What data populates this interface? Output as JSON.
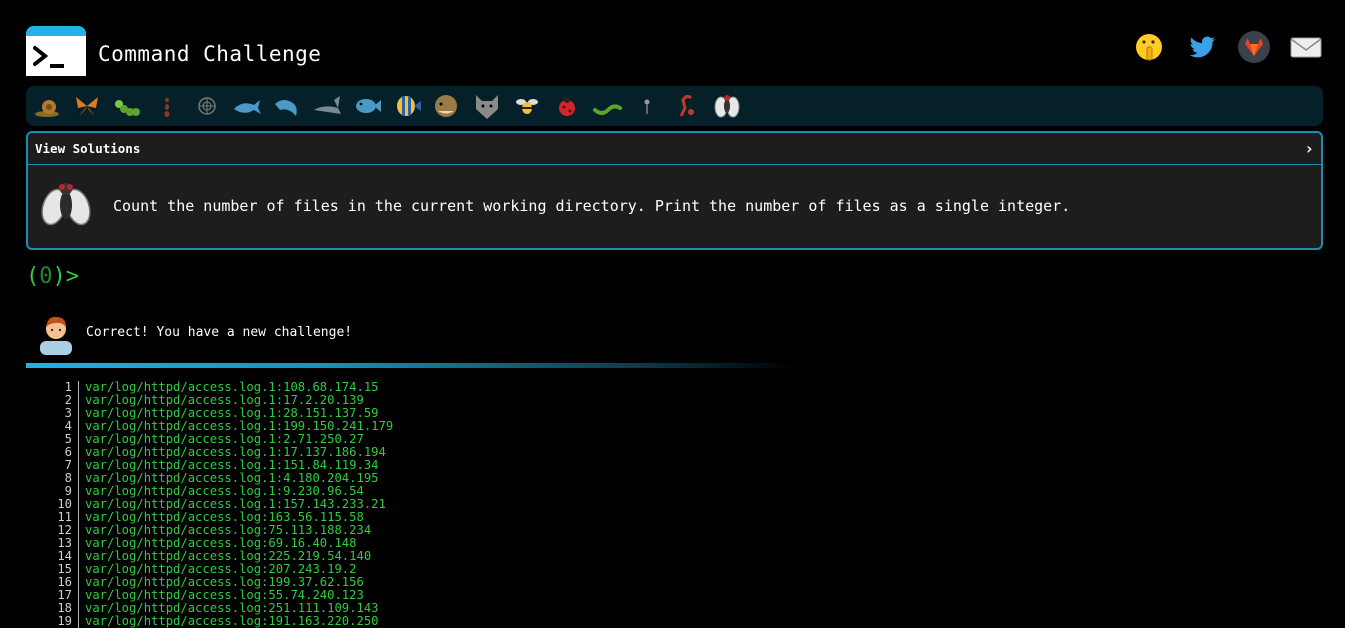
{
  "header": {
    "title": "Command Challenge",
    "social": [
      "shush-emoji-icon",
      "twitter-icon",
      "gitlab-icon",
      "mail-icon"
    ]
  },
  "critters": [
    "snail",
    "butterfly",
    "caterpillar",
    "ant",
    "spider-web",
    "whale",
    "dolphin",
    "shark",
    "fish",
    "tropical-fish",
    "blowfish",
    "wolf",
    "bee",
    "ladybug",
    "worm",
    "mosquito",
    "scorpion",
    "fly"
  ],
  "solutions": {
    "label": "View Solutions",
    "challenge": "Count the number of files in the current working directory. Print the number of files as a single integer."
  },
  "prompt": {
    "open": "(",
    "count": "0",
    "close": ")>"
  },
  "message": {
    "text": "Correct! You have a new challenge!"
  },
  "output": {
    "lines": [
      {
        "n": "1",
        "t": "var/log/httpd/access.log.1:108.68.174.15"
      },
      {
        "n": "2",
        "t": "var/log/httpd/access.log.1:17.2.20.139"
      },
      {
        "n": "3",
        "t": "var/log/httpd/access.log.1:28.151.137.59"
      },
      {
        "n": "4",
        "t": "var/log/httpd/access.log.1:199.150.241.179"
      },
      {
        "n": "5",
        "t": "var/log/httpd/access.log.1:2.71.250.27"
      },
      {
        "n": "6",
        "t": "var/log/httpd/access.log.1:17.137.186.194"
      },
      {
        "n": "7",
        "t": "var/log/httpd/access.log.1:151.84.119.34"
      },
      {
        "n": "8",
        "t": "var/log/httpd/access.log.1:4.180.204.195"
      },
      {
        "n": "9",
        "t": "var/log/httpd/access.log.1:9.230.96.54"
      },
      {
        "n": "10",
        "t": "var/log/httpd/access.log.1:157.143.233.21"
      },
      {
        "n": "11",
        "t": "var/log/httpd/access.log:163.56.115.58"
      },
      {
        "n": "12",
        "t": "var/log/httpd/access.log:75.113.188.234"
      },
      {
        "n": "13",
        "t": "var/log/httpd/access.log:69.16.40.148"
      },
      {
        "n": "14",
        "t": "var/log/httpd/access.log:225.219.54.140"
      },
      {
        "n": "15",
        "t": "var/log/httpd/access.log:207.243.19.2"
      },
      {
        "n": "16",
        "t": "var/log/httpd/access.log:199.37.62.156"
      },
      {
        "n": "17",
        "t": "var/log/httpd/access.log:55.74.240.123"
      },
      {
        "n": "18",
        "t": "var/log/httpd/access.log:251.111.109.143"
      },
      {
        "n": "19",
        "t": "var/log/httpd/access.log:191.163.220.250"
      }
    ]
  }
}
